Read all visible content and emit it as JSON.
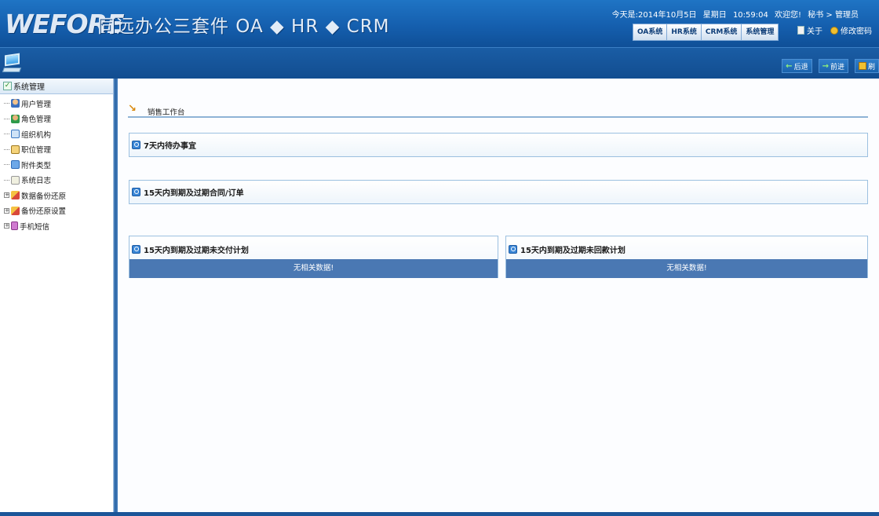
{
  "header": {
    "logo_text": "WEFORE",
    "product": "同远办公三套件 OA ◆ HR ◆ CRM",
    "today_label": "今天是:",
    "date": "2014年10月5日",
    "weekday": "星期日",
    "time": "10:59:04",
    "welcome": "欢迎您!",
    "user": "秘书 > 管理员",
    "sys_tabs": [
      "OA系统",
      "HR系统",
      "CRM系统",
      "系统管理"
    ],
    "about_label": "关于",
    "change_password_label": "修改密码"
  },
  "toolbar": {
    "back_label": "后退",
    "forward_label": "前进",
    "refresh_label": "刷"
  },
  "sidebar": {
    "root_label": "系统管理",
    "items": [
      {
        "label": "用户管理"
      },
      {
        "label": "角色管理"
      },
      {
        "label": "组织机构"
      },
      {
        "label": "职位管理"
      },
      {
        "label": "附件类型"
      },
      {
        "label": "系统日志"
      },
      {
        "label": "数据备份还原"
      },
      {
        "label": "备份还原设置"
      },
      {
        "label": "手机短信"
      }
    ]
  },
  "main": {
    "breadcrumb": "销售工作台",
    "panels": [
      {
        "title": "7天内待办事宜"
      },
      {
        "title": "15天内到期及过期合同/订单"
      },
      {
        "title": "15天内到期及过期未交付计划",
        "empty_text": "无相关数据!"
      },
      {
        "title": "15天内到期及过期未回款计划",
        "empty_text": "无相关数据!"
      }
    ]
  }
}
